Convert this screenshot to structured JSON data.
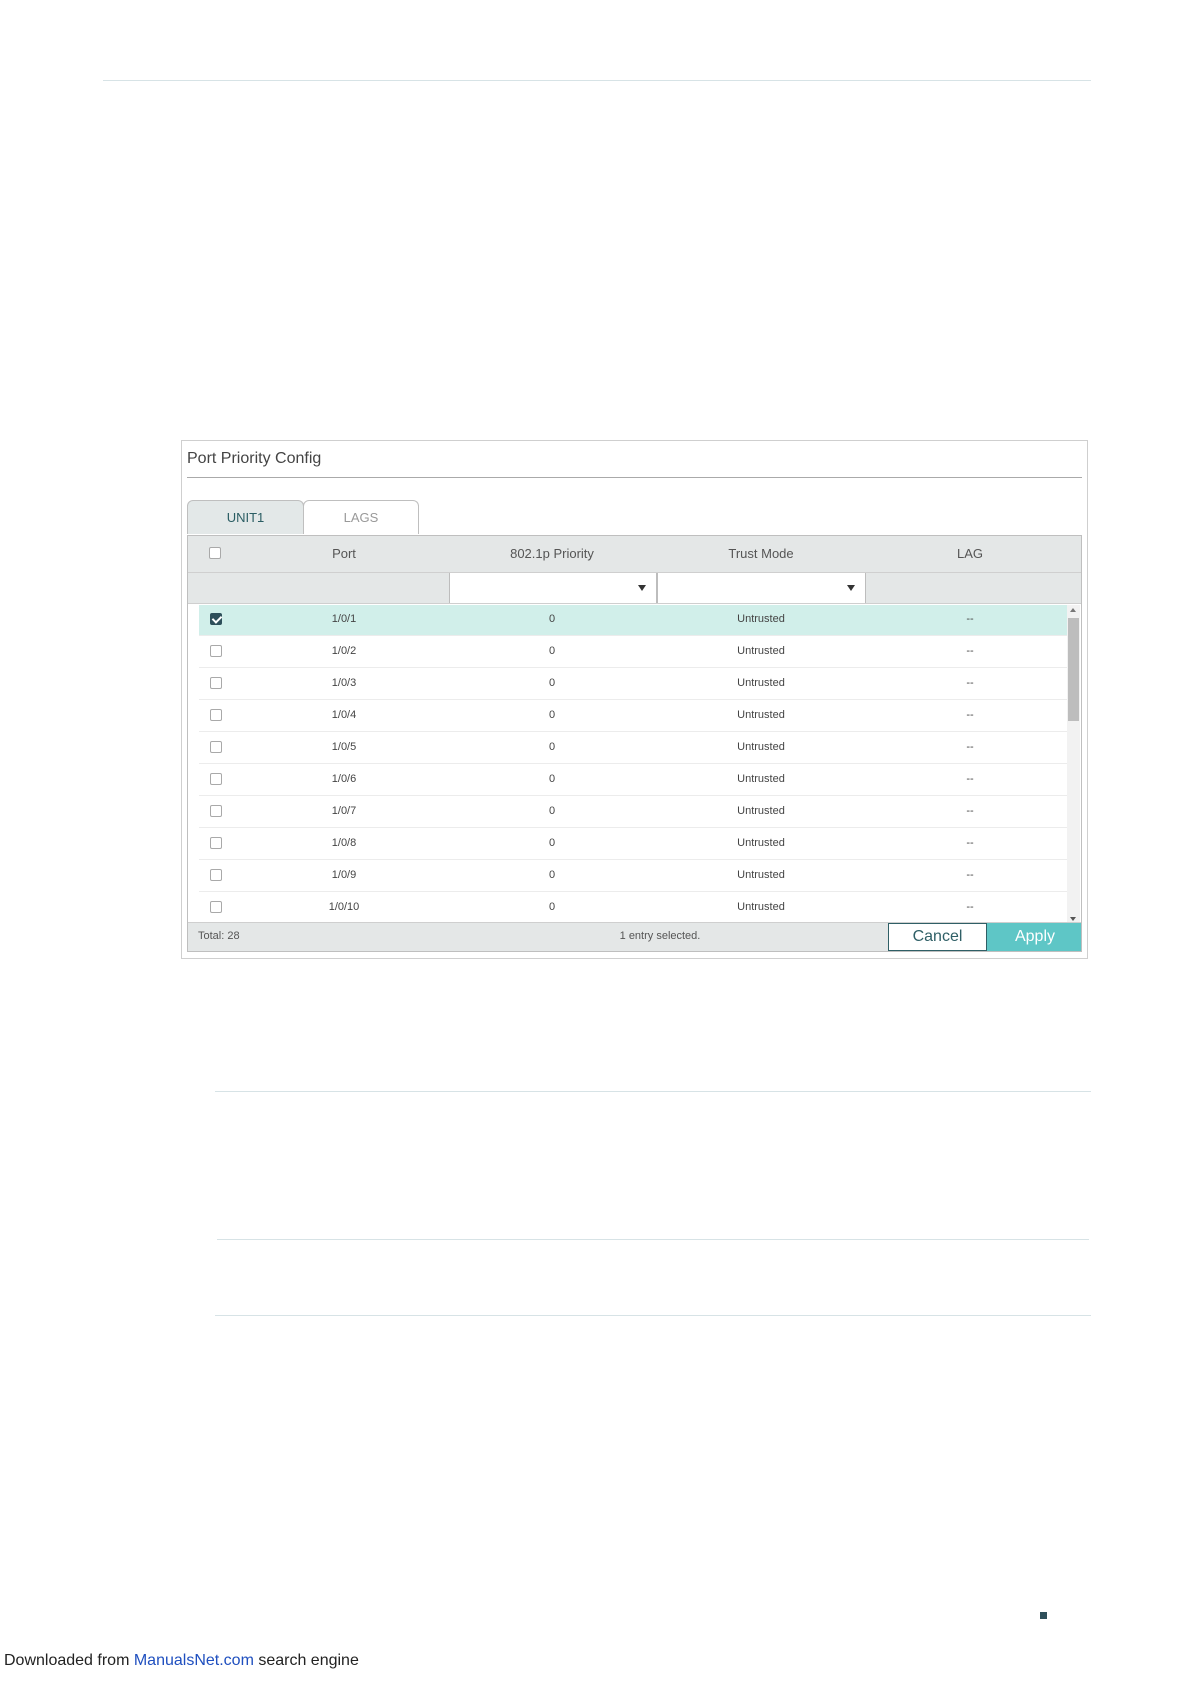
{
  "panel": {
    "title": "Port Priority Config",
    "tabs": [
      "UNIT1",
      "LAGS"
    ],
    "columns": [
      "Port",
      "802.1p Priority",
      "Trust Mode",
      "LAG"
    ],
    "rows": [
      {
        "port": "1/0/1",
        "priority": "0",
        "trust": "Untrusted",
        "lag": "--",
        "checked": true
      },
      {
        "port": "1/0/2",
        "priority": "0",
        "trust": "Untrusted",
        "lag": "--",
        "checked": false
      },
      {
        "port": "1/0/3",
        "priority": "0",
        "trust": "Untrusted",
        "lag": "--",
        "checked": false
      },
      {
        "port": "1/0/4",
        "priority": "0",
        "trust": "Untrusted",
        "lag": "--",
        "checked": false
      },
      {
        "port": "1/0/5",
        "priority": "0",
        "trust": "Untrusted",
        "lag": "--",
        "checked": false
      },
      {
        "port": "1/0/6",
        "priority": "0",
        "trust": "Untrusted",
        "lag": "--",
        "checked": false
      },
      {
        "port": "1/0/7",
        "priority": "0",
        "trust": "Untrusted",
        "lag": "--",
        "checked": false
      },
      {
        "port": "1/0/8",
        "priority": "0",
        "trust": "Untrusted",
        "lag": "--",
        "checked": false
      },
      {
        "port": "1/0/9",
        "priority": "0",
        "trust": "Untrusted",
        "lag": "--",
        "checked": false
      },
      {
        "port": "1/0/10",
        "priority": "0",
        "trust": "Untrusted",
        "lag": "--",
        "checked": false
      }
    ],
    "footer": {
      "total": "Total: 28",
      "selected": "1 entry selected.",
      "cancel": "Cancel",
      "apply": "Apply"
    }
  },
  "download": {
    "prefix": "Downloaded from ",
    "link": "ManualsNet.com",
    "suffix": " search engine"
  },
  "colors": {
    "accent": "#5ec6c6",
    "selected_row": "#d1efea",
    "dark_teal": "#2e4f5a"
  }
}
